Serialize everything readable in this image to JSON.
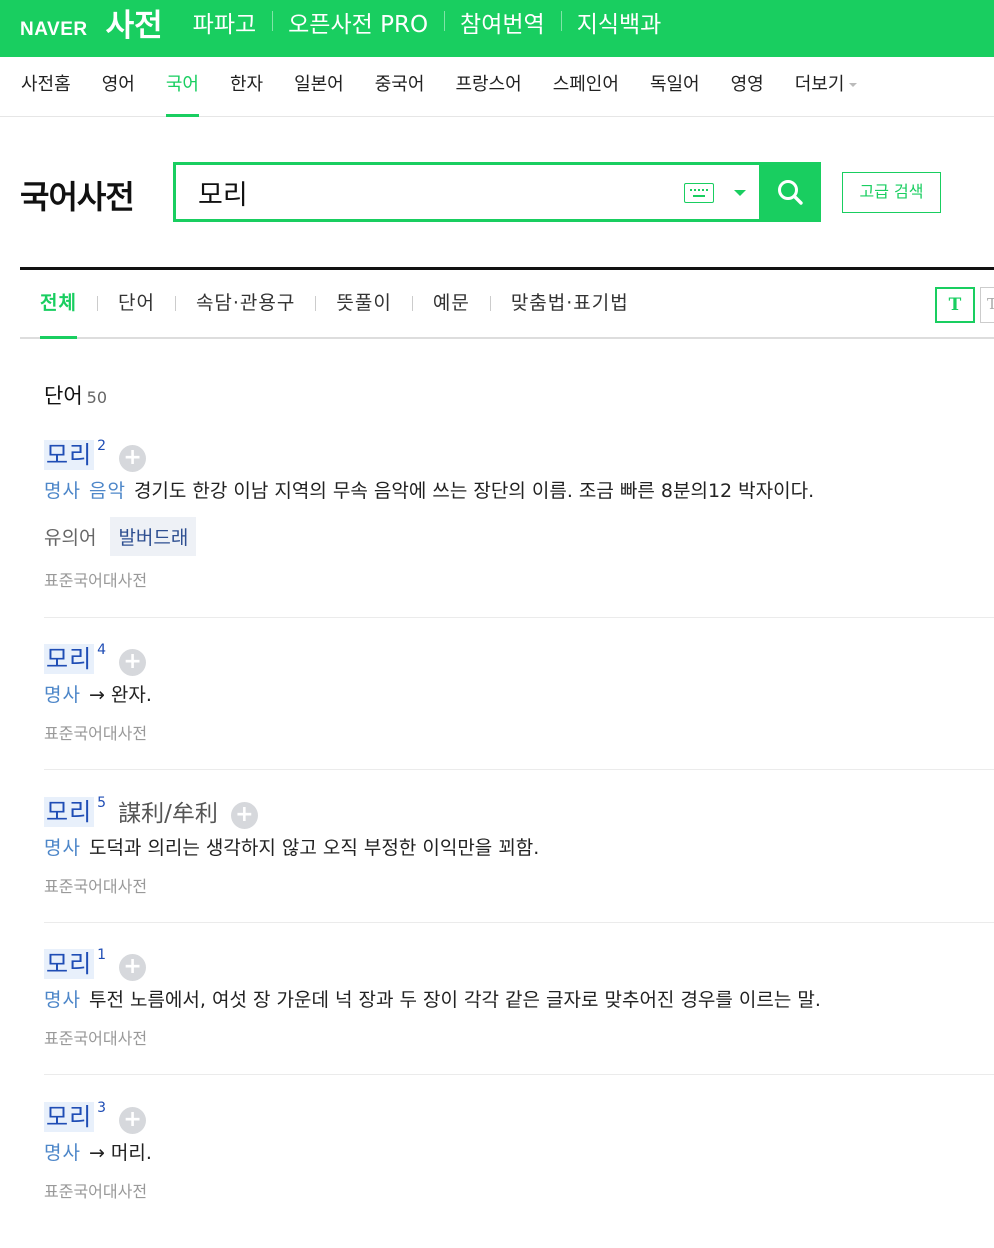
{
  "header": {
    "brand": "NAVER",
    "service": "사전",
    "nav": [
      "파파고",
      "오픈사전 PRO",
      "참여번역",
      "지식백과"
    ]
  },
  "lang_tabs": [
    "사전홈",
    "영어",
    "국어",
    "한자",
    "일본어",
    "중국어",
    "프랑스어",
    "스페인어",
    "독일어",
    "영영",
    "더보기"
  ],
  "active_lang": "국어",
  "dict_title": "국어사전",
  "search": {
    "value": "모리",
    "button": "search-icon",
    "advanced_label": "고급 검색"
  },
  "filter_tabs": [
    "전체",
    "단어",
    "속담·관용구",
    "뜻풀이",
    "예문",
    "맞춤법·표기법"
  ],
  "active_filter": "전체",
  "font_button": "T",
  "section": {
    "title": "단어",
    "count": "50"
  },
  "entries": [
    {
      "word": "모리",
      "sup": "2",
      "hanja": "",
      "pos": "명사",
      "field": "음악",
      "meaning": "경기도 한강 이남 지역의 무속 음악에 쓰는 장단의 이름. 조금 빠른 8분의12 박자이다.",
      "synonym_label": "유의어",
      "synonym": "발버드래",
      "source": "표준국어대사전"
    },
    {
      "word": "모리",
      "sup": "4",
      "hanja": "",
      "pos": "명사",
      "field": "",
      "meaning": "→ 완자.",
      "source": "표준국어대사전"
    },
    {
      "word": "모리",
      "sup": "5",
      "hanja": "謀利/牟利",
      "pos": "명사",
      "field": "",
      "meaning": "도덕과 의리는 생각하지 않고 오직 부정한 이익만을 꾀함.",
      "source": "표준국어대사전"
    },
    {
      "word": "모리",
      "sup": "1",
      "hanja": "",
      "pos": "명사",
      "field": "",
      "meaning": "투전 노름에서, 여섯 장 가운데 넉 장과 두 장이 각각 같은 글자로 맞추어진 경우를 이르는 말.",
      "source": "표준국어대사전"
    },
    {
      "word": "모리",
      "sup": "3",
      "hanja": "",
      "pos": "명사",
      "field": "",
      "meaning": "→ 머리.",
      "source": "표준국어대사전"
    }
  ],
  "colors": {
    "brand_green": "#19ce60",
    "link_blue": "#1f4db5",
    "pos_blue": "#4e87c9"
  }
}
